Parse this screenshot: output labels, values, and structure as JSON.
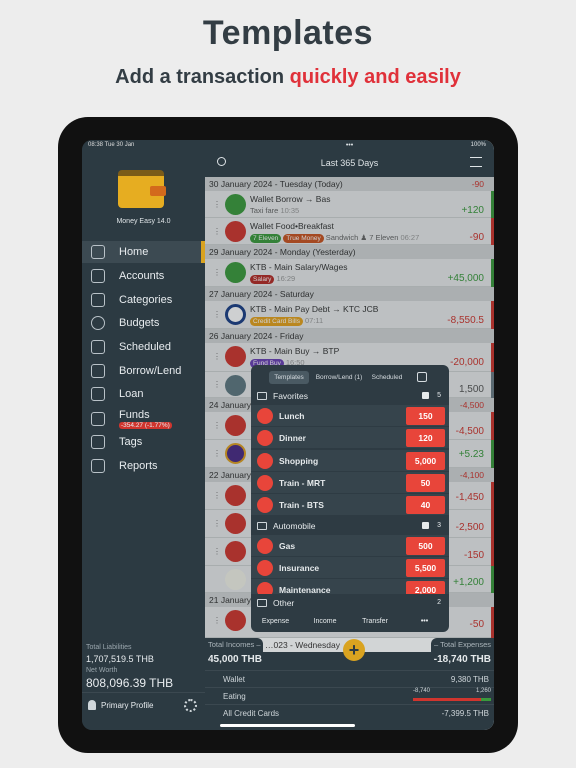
{
  "promo": {
    "title": "Templates",
    "subtitle_plain": "Add a transaction ",
    "subtitle_highlight": "quickly and easily"
  },
  "status_bar": {
    "time": "08:38",
    "date": "Tue 30 Jan",
    "battery": "100%"
  },
  "app": {
    "name": "Money Easy 14.0"
  },
  "sidebar": {
    "items": [
      {
        "label": "Home",
        "icon": "home-icon",
        "active": true
      },
      {
        "label": "Accounts",
        "icon": "bank-icon"
      },
      {
        "label": "Categories",
        "icon": "grid-icon"
      },
      {
        "label": "Budgets",
        "icon": "budget-icon"
      },
      {
        "label": "Scheduled",
        "icon": "calendar-icon"
      },
      {
        "label": "Borrow/Lend",
        "icon": "borrow-icon"
      },
      {
        "label": "Loan",
        "icon": "loan-icon"
      },
      {
        "label": "Funds",
        "icon": "funds-icon",
        "badge": "-354.27 (-1.77%)"
      },
      {
        "label": "Tags",
        "icon": "tag-icon"
      },
      {
        "label": "Reports",
        "icon": "chart-icon"
      }
    ],
    "total_liabilities_label": "Total Liabilities",
    "total_liabilities": "1,707,519.5 THB",
    "net_worth_label": "Net Worth",
    "net_worth": "808,096.39 THB",
    "profile": "Primary Profile"
  },
  "nav": {
    "title": "Last 365 Days"
  },
  "list": {
    "d30": {
      "label": "30 January 2024 - Tuesday (Today)",
      "total": "-90"
    },
    "r1": {
      "title": "Wallet Borrow → Bas",
      "note": "Taxi fare",
      "time": "10:35",
      "amount": "+120"
    },
    "r2": {
      "title": "Wallet Food•Breakfast",
      "tag1": "7 Eleven",
      "tag2": "True Money",
      "note": "Sandwich",
      "payee": "7 Eleven",
      "time": "06:27",
      "amount": "-90"
    },
    "d29": {
      "label": "29 January 2024 - Monday (Yesterday)"
    },
    "r3": {
      "title": "KTB - Main Salary/Wages",
      "tag1": "Salary",
      "time": "16:29",
      "amount": "+45,000"
    },
    "d27": {
      "label": "27 January 2024 - Saturday"
    },
    "r4": {
      "title": "KTB - Main Pay Debt → KTC JCB",
      "tag1": "Credit Card Bills",
      "time": "07:11",
      "amount": "-8,550.5"
    },
    "d26": {
      "label": "26 January 2024 - Friday"
    },
    "r5": {
      "title": "KTB - Main Buy → BTP",
      "tag1": "Fund Buy",
      "time": "16:50",
      "amount": "-20,000"
    },
    "r6": {
      "amount": "1,500"
    },
    "d24": {
      "label": "24 January",
      "total": "-4,500"
    },
    "r7": {
      "amount": "-4,500"
    },
    "r8": {
      "amount": "+5.23"
    },
    "d22": {
      "label": "22 January",
      "total": "-4,100"
    },
    "r9": {
      "amount": "-1,450"
    },
    "r10": {
      "amount": "-2,500"
    },
    "r11": {
      "amount": "-150"
    },
    "r12": {
      "amount": "+1,200"
    },
    "d21": {
      "label": "21 January"
    },
    "r13": {
      "amount": "-50"
    },
    "d_next": {
      "label": "…023 - Wednesday"
    }
  },
  "popup": {
    "tabs": [
      "Templates",
      "Borrow/Lend (1)",
      "Scheduled"
    ],
    "groups": [
      {
        "name": "Favorites",
        "count": "5",
        "items": [
          {
            "name": "Lunch",
            "value": "150"
          },
          {
            "name": "Dinner",
            "value": "120"
          },
          {
            "name": "Shopping",
            "value": "5,000"
          },
          {
            "name": "Train - MRT",
            "value": "50"
          },
          {
            "name": "Train - BTS",
            "value": "40"
          }
        ]
      },
      {
        "name": "Automobile",
        "count": "3",
        "items": [
          {
            "name": "Gas",
            "value": "500"
          },
          {
            "name": "Insurance",
            "value": "5,500"
          },
          {
            "name": "Maintenance",
            "value": "2,000"
          }
        ]
      },
      {
        "name": "Other",
        "count": "2"
      }
    ],
    "buttons": [
      "Expense",
      "Income",
      "Transfer",
      "•••"
    ]
  },
  "summary": {
    "incomes_label": "Total Incomes –",
    "incomes": "45,000 THB",
    "expenses_label": "– Total Expenses",
    "expenses": "-18,740 THB",
    "wallet_label": "Wallet",
    "wallet": "9,380 THB",
    "eating_label": "Eating",
    "eating_spent": "-8,740",
    "eating_left": "1,260",
    "eating_fraction": 0.87,
    "cc_label": "All Credit Cards",
    "cc": "-7,399.5 THB"
  },
  "colors": {
    "accent": "#d9a320",
    "expense": "#e8453a",
    "income": "#3a9a3c",
    "sidebar": "#2c3a42"
  }
}
